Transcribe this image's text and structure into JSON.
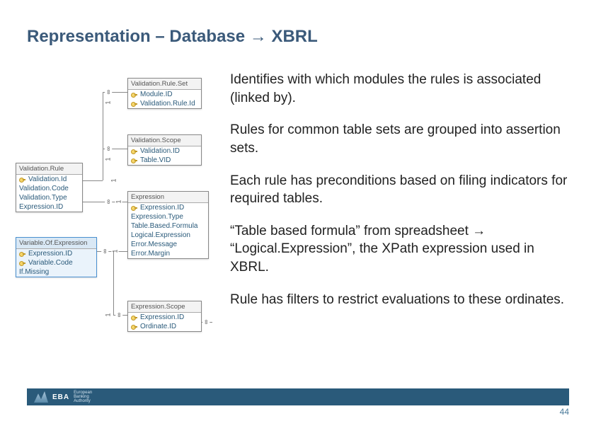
{
  "title": "Representation – Database → XBRL",
  "paragraphs": [
    "Identifies with which modules the rules is associated (linked by).",
    "Rules for common table sets are grouped into assertion sets.",
    "Each rule has preconditions based on filing indicators for required tables.",
    "“Table based formula” from spreadsheet → “Logical.Expression”, the XPath expression used in XBRL.",
    "Rule has filters to restrict evaluations to these ordinates."
  ],
  "diagram": {
    "validationRule": {
      "title": "Validation.Rule",
      "fields": [
        "Validation.Id",
        "Validation.Code",
        "Validation.Type",
        "Expression.ID"
      ]
    },
    "validationRuleSet": {
      "title": "Validation.Rule.Set",
      "fields": [
        "Module.ID",
        "Validation.Rule.Id"
      ]
    },
    "validationScope": {
      "title": "Validation.Scope",
      "fields": [
        "Validation.ID",
        "Table.VID"
      ]
    },
    "expression": {
      "title": "Expression",
      "fields": [
        "Expression.ID",
        "Expression.Type",
        "Table.Based.Formula",
        "Logical.Expression",
        "Error.Message",
        "Error.Margin"
      ]
    },
    "variableOfExpression": {
      "title": "Variable.Of.Expression",
      "fields": [
        "Expression.ID",
        "Variable.Code",
        "If.Missing"
      ]
    },
    "expressionScope": {
      "title": "Expression.Scope",
      "fields": [
        "Expression.ID",
        "Ordinate.ID"
      ]
    }
  },
  "cardinalities": {
    "one": "1",
    "many": "∞"
  },
  "footer": {
    "brand": "EBA",
    "subtitle1": "European",
    "subtitle2": "Banking",
    "subtitle3": "Authority"
  },
  "page": "44"
}
